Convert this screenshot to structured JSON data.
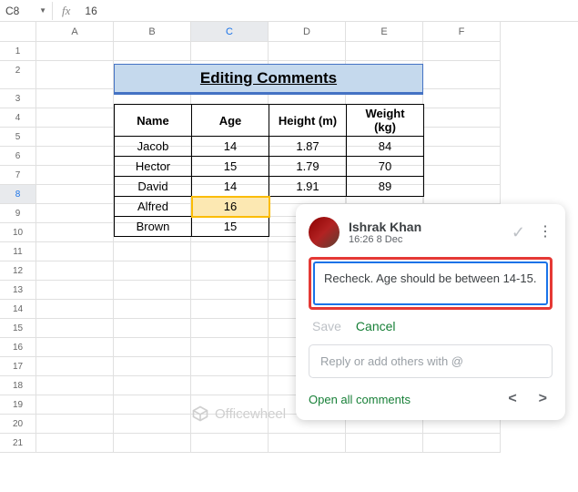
{
  "name_box": "C8",
  "formula_value": "16",
  "columns": [
    "A",
    "B",
    "C",
    "D",
    "E",
    "F"
  ],
  "row_count": 21,
  "selected_col_index": 2,
  "selected_row_index": 7,
  "title": "Editing Comments",
  "table": {
    "headers": [
      "Name",
      "Age",
      "Height (m)",
      "Weight (kg)"
    ],
    "rows": [
      [
        "Jacob",
        "14",
        "1.87",
        "84"
      ],
      [
        "Hector",
        "15",
        "1.79",
        "70"
      ],
      [
        "David",
        "14",
        "1.91",
        "89"
      ],
      [
        "Alfred",
        "16",
        "",
        ""
      ],
      [
        "Brown",
        "15",
        "",
        ""
      ]
    ],
    "active": {
      "row": 3,
      "col": 1
    }
  },
  "comment": {
    "author": "Ishrak Khan",
    "timestamp": "16:26 8 Dec",
    "text": "Recheck. Age should be between 14-15.",
    "save": "Save",
    "cancel": "Cancel",
    "reply_placeholder": "Reply or add others with @",
    "open_all": "Open all comments"
  },
  "watermark": "Officewheel"
}
